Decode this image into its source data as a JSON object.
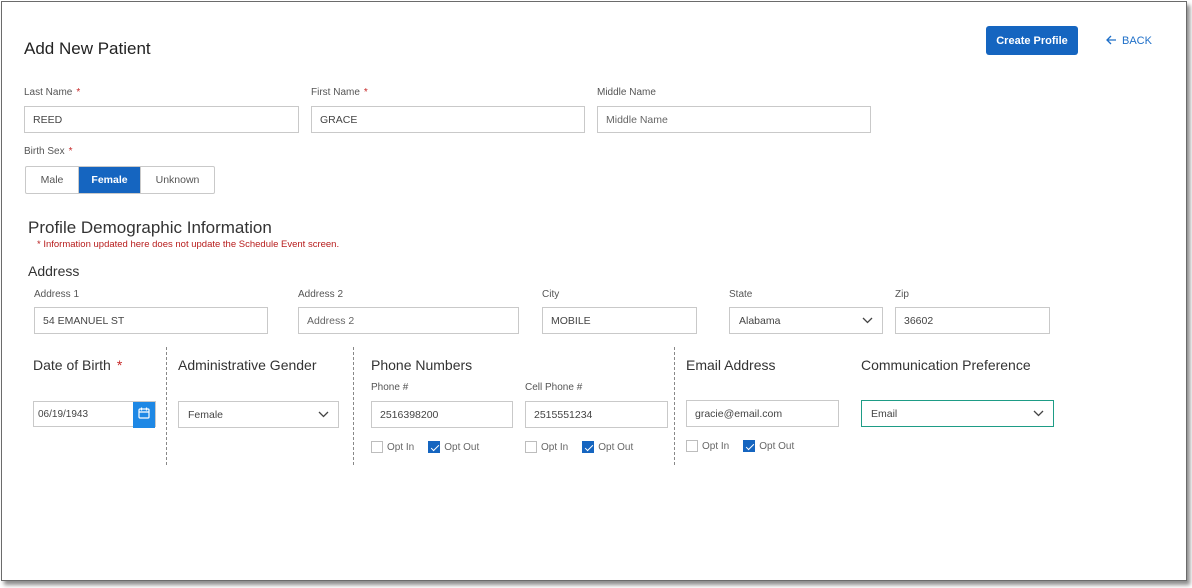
{
  "header": {
    "title": "Add New Patient",
    "create_button": "Create Profile",
    "back_link": "BACK"
  },
  "name_fields": {
    "last_name": {
      "label": "Last Name",
      "required": "*",
      "value": "REED"
    },
    "first_name": {
      "label": "First Name",
      "required": "*",
      "value": "GRACE"
    },
    "middle_name": {
      "label": "Middle Name",
      "placeholder": "Middle Name"
    }
  },
  "birth_sex": {
    "label": "Birth Sex",
    "required": "*",
    "options": [
      "Male",
      "Female",
      "Unknown"
    ],
    "selected": "Female"
  },
  "demographics": {
    "title": "Profile Demographic Information",
    "note": "* Information updated here does not update the Schedule Event screen."
  },
  "address": {
    "title": "Address",
    "address1": {
      "label": "Address 1",
      "value": "54 EMANUEL ST"
    },
    "address2": {
      "label": "Address 2",
      "placeholder": "Address 2"
    },
    "city": {
      "label": "City",
      "value": "MOBILE"
    },
    "state": {
      "label": "State",
      "value": "Alabama"
    },
    "zip": {
      "label": "Zip",
      "value": "36602"
    }
  },
  "dob": {
    "title": "Date of Birth",
    "required": "*",
    "value": "06/19/1943"
  },
  "admin_gender": {
    "title": "Administrative Gender",
    "value": "Female"
  },
  "phones": {
    "title": "Phone Numbers",
    "phone": {
      "label": "Phone #",
      "value": "2516398200",
      "opt_in": "Opt In",
      "opt_out": "Opt Out",
      "opted_out": true
    },
    "cell": {
      "label": "Cell Phone #",
      "value": "2515551234",
      "opt_in": "Opt In",
      "opt_out": "Opt Out",
      "opted_out": true
    }
  },
  "email": {
    "title": "Email Address",
    "value": "gracie@email.com",
    "opt_in": "Opt In",
    "opt_out": "Opt Out",
    "opted_out": true
  },
  "comm_pref": {
    "title": "Communication Preference",
    "value": "Email"
  },
  "colors": {
    "primary": "#1565c0",
    "required": "#c62828",
    "note": "#b71c1c",
    "focus_border": "#1e9c86"
  },
  "icons": {
    "back": "arrow-left-icon",
    "calendar": "calendar-icon",
    "dropdown": "chevron-down-icon",
    "check": "check-icon"
  }
}
